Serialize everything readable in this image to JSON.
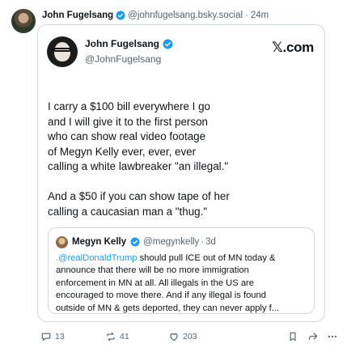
{
  "author": {
    "display_name": "John Fugelsang",
    "handle": "@johnfugelsang.bsky.social",
    "separator": "·",
    "time": "24m"
  },
  "embed": {
    "display_name": "John Fugelsang",
    "handle": "@JohnFugelsang",
    "source": "𝕏.com",
    "lines": [
      "I carry a $100 bill everywhere I go",
      "and I will give it to the first person",
      "who can show real video footage",
      "of Megyn Kelly ever, ever, ever",
      "calling a white lawbreaker \"an illegal.\"",
      "And a $50 if you can show tape of her",
      "calling a caucasian man a \"thug.\""
    ],
    "quote": {
      "display_name": "Megyn Kelly",
      "handle": "@megynkelly",
      "separator": "·",
      "time": "3d",
      "mention": ".@realDonaldTrump",
      "first_line_rest": " should pull ICE out of MN today &",
      "lines": [
        "announce that there will be no more immigration",
        "enforcement in MN at all. All illegals in the US are",
        "encouraged to move there. And if any illegal is found",
        "outside of MN & gets deported, they can never apply f..."
      ]
    }
  },
  "actions": {
    "reply_count": "13",
    "repost_count": "41",
    "like_count": "203"
  },
  "colors": {
    "accent": "#1d9bf0",
    "muted": "#536471",
    "border": "#cfd9de"
  },
  "icons": [
    "reply-icon",
    "repost-icon",
    "like-icon",
    "bookmark-icon",
    "share-icon",
    "more-icon",
    "verified-icon"
  ]
}
